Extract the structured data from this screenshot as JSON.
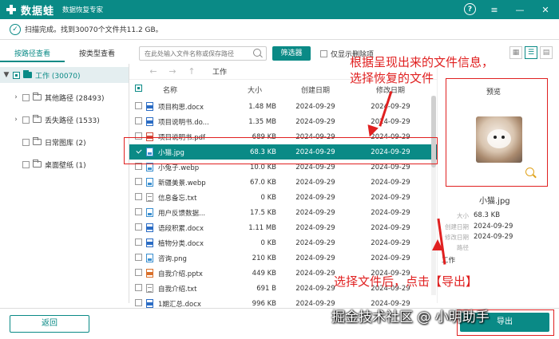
{
  "titlebar": {
    "app_name": "数据蛙",
    "subtitle": "数据恢复专家",
    "help_icon": "?",
    "menu_icon": "≡",
    "minimize_icon": "—",
    "close_icon": "✕"
  },
  "status": {
    "text": "扫描完成。找到30070个文件共11.2 GB。"
  },
  "tabs": {
    "by_path": "按路径查看",
    "by_type": "按类型查看"
  },
  "toolbar": {
    "search_placeholder": "在此处输入文件名称或保存路径",
    "filter_label": "筛选器",
    "only_deleted_label": "仅显示删除项",
    "view_grid_icon": "▦",
    "view_list_icon": "☰",
    "view_detail_icon": "▤"
  },
  "tree": [
    {
      "label": "工作 (30070)",
      "expander": "▼"
    },
    {
      "label": "其他路径 (28493)",
      "expander": "›"
    },
    {
      "label": "丢失路径 (1533)",
      "expander": "›"
    },
    {
      "label": "日常图库 (2)",
      "expander": ""
    },
    {
      "label": "桌面壁纸 (1)",
      "expander": ""
    }
  ],
  "nav": {
    "back_icon": "←",
    "forward_icon": "→",
    "up_icon": "↑",
    "crumb": "工作"
  },
  "table": {
    "headers": {
      "name": "名称",
      "size": "大小",
      "created": "创建日期",
      "modified": "修改日期"
    },
    "rows": [
      {
        "name": "项目构思.docx",
        "size": "1.48 MB",
        "created": "2024-09-29",
        "modified": "2024-09-29",
        "type": "doc"
      },
      {
        "name": "项目说明书.do...",
        "size": "1.35 MB",
        "created": "2024-09-29",
        "modified": "2024-09-29",
        "type": "doc"
      },
      {
        "name": "项目说明书.pdf",
        "size": "689 KB",
        "created": "2024-09-29",
        "modified": "2024-09-29",
        "type": "pdf"
      },
      {
        "name": "小猫.jpg",
        "size": "68.3 KB",
        "created": "2024-09-29",
        "modified": "2024-09-29",
        "type": "img"
      },
      {
        "name": "小兔子.webp",
        "size": "10.0 KB",
        "created": "2024-09-29",
        "modified": "2024-09-29",
        "type": "img"
      },
      {
        "name": "新疆美景.webp",
        "size": "67.0 KB",
        "created": "2024-09-29",
        "modified": "2024-09-29",
        "type": "img"
      },
      {
        "name": "信息备忘.txt",
        "size": "0 KB",
        "created": "2024-09-29",
        "modified": "2024-09-29",
        "type": "txt"
      },
      {
        "name": "用户反馈数据...",
        "size": "17.5 KB",
        "created": "2024-09-29",
        "modified": "2024-09-29",
        "type": "img"
      },
      {
        "name": "语段积累.docx",
        "size": "1.11 MB",
        "created": "2024-09-29",
        "modified": "2024-09-29",
        "type": "doc"
      },
      {
        "name": "植物分类.docx",
        "size": "0 KB",
        "created": "2024-09-29",
        "modified": "2024-09-29",
        "type": "doc"
      },
      {
        "name": "咨询.png",
        "size": "210 KB",
        "created": "2024-09-29",
        "modified": "2024-09-29",
        "type": "img"
      },
      {
        "name": "自我介绍.pptx",
        "size": "449 KB",
        "created": "2024-09-29",
        "modified": "2024-09-29",
        "type": "ppt"
      },
      {
        "name": "自我介绍.txt",
        "size": "691 B",
        "created": "2024-09-29",
        "modified": "2024-09-29",
        "type": "txt"
      },
      {
        "name": "1期汇总.docx",
        "size": "996 KB",
        "created": "2024-09-29",
        "modified": "2024-09-29",
        "type": "doc"
      }
    ]
  },
  "preview": {
    "title": "预览",
    "filename": "小猫.jpg",
    "meta": [
      {
        "k": "大小",
        "v": "68.3 KB"
      },
      {
        "k": "创建日期",
        "v": "2024-09-29"
      },
      {
        "k": "修改日期",
        "v": "2024-09-29"
      },
      {
        "k": "路径",
        "v": ""
      }
    ],
    "work": "工作"
  },
  "footer": {
    "back_label": "返回",
    "export_label": "导出"
  },
  "annotations": {
    "top": "根据呈现出来的文件信息，\n选择恢复的文件",
    "bottom": "选择文件后，点击【导出】",
    "watermark": "掘金技术社区 @ 小明助手"
  },
  "colors": {
    "accent": "#0a8a86",
    "annotation": "#e02020"
  }
}
